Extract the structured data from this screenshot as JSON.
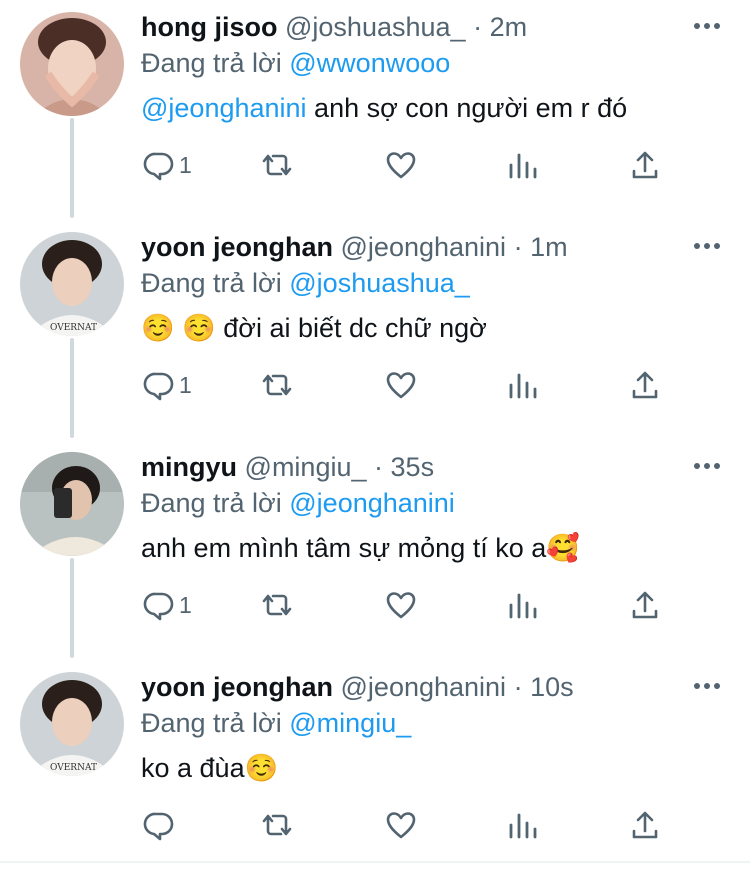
{
  "tweets": [
    {
      "name": "hong jisoo",
      "handle": "@joshuashua_",
      "dot": "·",
      "time": "2m",
      "reply_prefix": "Đang trả lời ",
      "reply_to": "@wwonwooo",
      "mention": "@jeonghanini",
      "text": " anh sợ con người em r đó",
      "reply_count": "1",
      "avatar_colors": {
        "bg": "#d8b4a8",
        "skin": "#f1d3c4",
        "hair": "#4b2f26"
      }
    },
    {
      "name": "yoon jeonghan",
      "handle": "@jeonghanini",
      "dot": "·",
      "time": "1m",
      "reply_prefix": "Đang trả lời ",
      "reply_to": "@joshuashua_",
      "mention": "",
      "text": "☺️ ☺️  đời ai biết dc chữ ngờ",
      "reply_count": "1",
      "avatar_colors": {
        "bg": "#cdd3d6",
        "skin": "#eccfbd",
        "hair": "#2a1f1a"
      }
    },
    {
      "name": "mingyu",
      "handle": "@mingiu_",
      "dot": "·",
      "time": "35s",
      "reply_prefix": "Đang trả lời ",
      "reply_to": "@jeonghanini",
      "mention": "",
      "text": "anh em mình tâm sự mỏng tí ko a🥰",
      "reply_count": "1",
      "avatar_colors": {
        "bg": "#b9c2c0",
        "skin": "#e2c3ae",
        "hair": "#1f1a18"
      }
    },
    {
      "name": "yoon jeonghan",
      "handle": "@jeonghanini",
      "dot": "·",
      "time": "10s",
      "reply_prefix": "Đang trả lời ",
      "reply_to": "@mingiu_",
      "mention": "",
      "text": "ko a đùa☺️",
      "reply_count": "",
      "avatar_colors": {
        "bg": "#cdd3d6",
        "skin": "#eccfbd",
        "hair": "#2a1f1a"
      }
    }
  ],
  "icons": {
    "reply": "reply-icon",
    "retweet": "retweet-icon",
    "like": "like-icon",
    "views": "views-icon",
    "share": "share-icon",
    "more": "more-icon"
  },
  "colors": {
    "accent": "#1d9bf0",
    "muted": "#536471",
    "text": "#0f1419",
    "thread": "#cfd9de"
  }
}
